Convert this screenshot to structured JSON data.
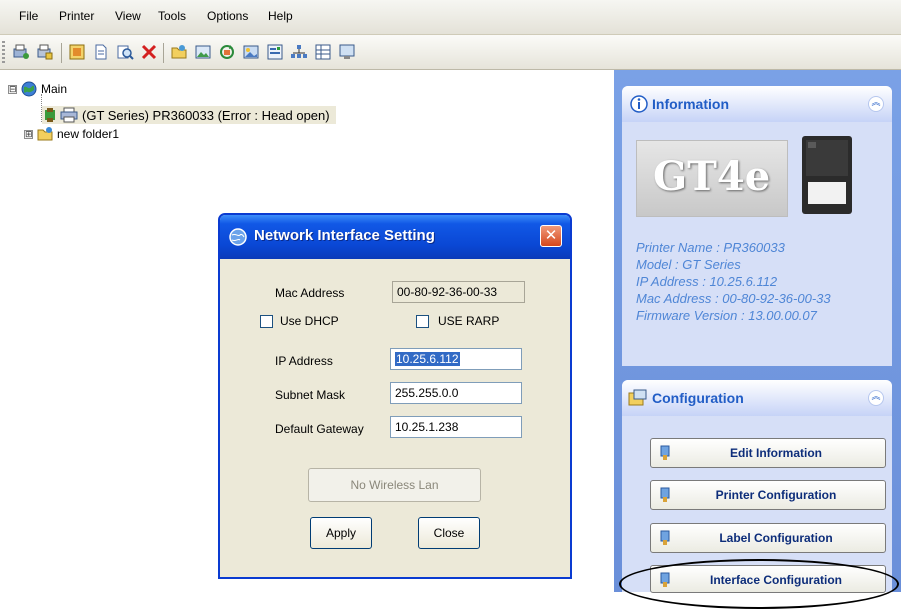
{
  "menu": {
    "items": [
      "File",
      "Printer",
      "View",
      "Tools",
      "Options",
      "Help"
    ]
  },
  "toolbar": {
    "icons": [
      "add-printer-icon",
      "printer-properties-icon",
      "status-icon",
      "document-icon",
      "search-icon",
      "delete-icon",
      "folder-icon",
      "image-icon",
      "refresh-icon",
      "picture-icon",
      "settings-icon",
      "network-icon",
      "grid-icon",
      "display-icon"
    ]
  },
  "tree": {
    "root_expander": "⊟",
    "root_label": "Main",
    "printer_label": "(GT Series) PR360033 (Error : Head open)",
    "folder_expander": "⊞",
    "folder_label": "new folder1"
  },
  "dialog": {
    "title": "Network Interface Setting",
    "close_glyph": "✕",
    "mac_label": "Mac Address",
    "mac_value": "00-80-92-36-00-33",
    "dhcp_label": "Use DHCP",
    "dhcp_checked": false,
    "rarp_label": "USE RARP",
    "rarp_checked": false,
    "ip_label": "IP Address",
    "ip_value": "10.25.6.112",
    "subnet_label": "Subnet Mask",
    "subnet_value": "255.255.0.0",
    "gateway_label": "Default Gateway",
    "gateway_value": "10.25.1.238",
    "wireless_button": "No Wireless Lan",
    "apply_button": "Apply",
    "close_button": "Close"
  },
  "info_panel": {
    "title": "Information",
    "collapse_glyph": "︽",
    "model_badge": "GT4e",
    "lines": [
      "Printer Name : PR360033",
      "Model : GT Series",
      "IP Address : 10.25.6.112",
      "Mac Address : 00-80-92-36-00-33",
      "Firmware Version : 13.00.00.07"
    ]
  },
  "config_panel": {
    "title": "Configuration",
    "collapse_glyph": "︽",
    "buttons": [
      "Edit Information",
      "Printer Configuration",
      "Label Configuration",
      "Interface Configuration"
    ]
  },
  "colors": {
    "title_bar": "#0a47d4",
    "panel_text": "#4f86d6",
    "config_text": "#0d2d7a",
    "highlight_ring": "#000000"
  }
}
